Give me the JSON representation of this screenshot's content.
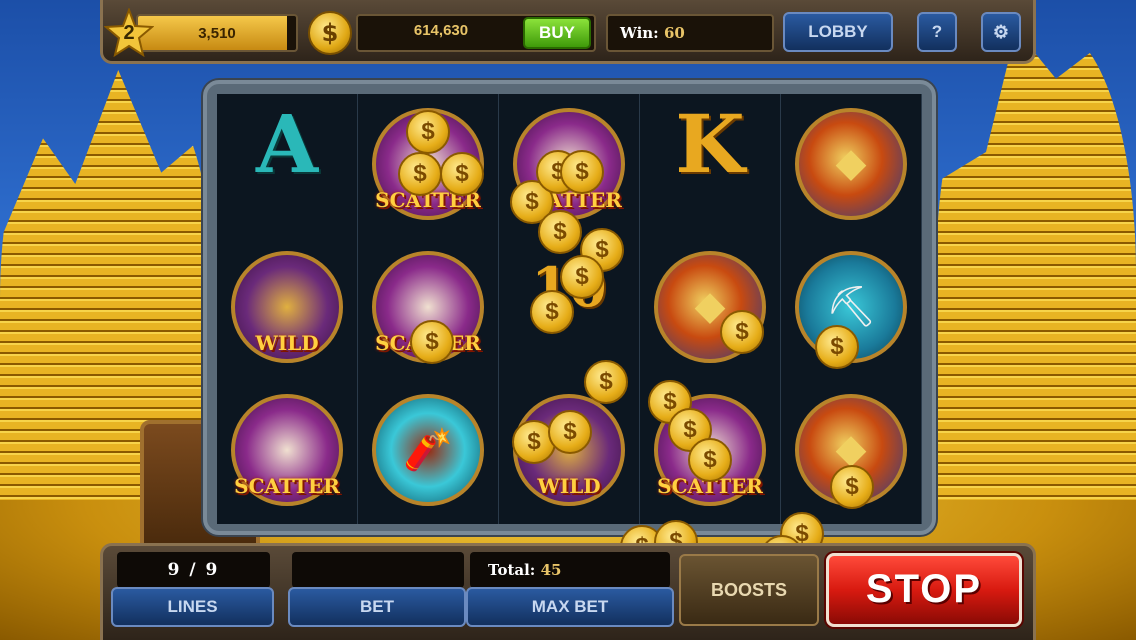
{
  "topbar": {
    "level": "2",
    "xp_value": "3,510",
    "xp_fill_fraction": 0.94,
    "coin_symbol": "$",
    "coins": "614,630",
    "buy_label": "BUY",
    "win_label": "Win:",
    "win_value": "60",
    "lobby_label": "LOBBY",
    "help_label": "?",
    "settings_icon": "gear-icon"
  },
  "reels": [
    {
      "symbols": [
        {
          "type": "letter",
          "text": "A"
        },
        {
          "type": "wild",
          "label": "WILD"
        },
        {
          "type": "scatter",
          "label": "SCATTER"
        }
      ]
    },
    {
      "symbols": [
        {
          "type": "scatter",
          "label": "SCATTER"
        },
        {
          "type": "scatter",
          "label": "SCATTER"
        },
        {
          "type": "tnt",
          "label": ""
        }
      ]
    },
    {
      "symbols": [
        {
          "type": "scatter",
          "label": "SCATTER"
        },
        {
          "type": "letter",
          "text": "10"
        },
        {
          "type": "wild",
          "label": "WILD"
        }
      ]
    },
    {
      "symbols": [
        {
          "type": "letter",
          "text": "K"
        },
        {
          "type": "gold",
          "label": ""
        },
        {
          "type": "scatter",
          "label": "SCATTER"
        }
      ]
    },
    {
      "symbols": [
        {
          "type": "gold",
          "label": ""
        },
        {
          "type": "pick",
          "label": ""
        },
        {
          "type": "gold",
          "label": ""
        }
      ]
    }
  ],
  "bottombar": {
    "lines_value": "9 / 9",
    "lines_label": "LINES",
    "bet_label": "BET",
    "total_label": "Total:",
    "total_value": "45",
    "maxbet_label": "MAX BET",
    "boosts_label": "BOOSTS",
    "stop_label": "STOP"
  },
  "colors": {
    "accent_gold": "#e8c468",
    "buy_green": "#3f9a0a",
    "stop_red": "#d81a10",
    "button_blue": "#12305e"
  }
}
